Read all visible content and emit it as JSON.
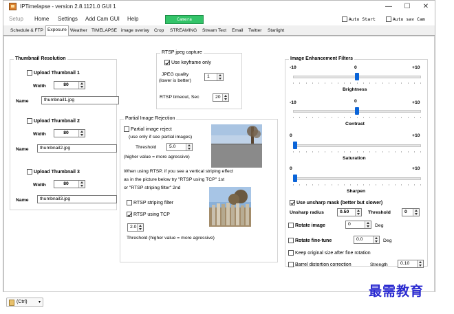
{
  "window": {
    "title": "IPTimelapse - version 2.8.1121.0   GUI 1",
    "minimize_glyph": "—",
    "maximize_glyph": "☐",
    "close_glyph": "✕"
  },
  "menu": {
    "items": [
      "Setup",
      "Home",
      "Settings",
      "Add Cam GUI",
      "Help"
    ],
    "camera_button": "Camera",
    "auto_start_label": "Auto Start",
    "auto_start_checked": false,
    "auto_sav_cam_label": "Auto sav Cam",
    "auto_sav_cam_checked": false
  },
  "tabs": [
    "Schedule & FTP",
    "Exposure",
    "Weather",
    "TIMELAPSE",
    "image overlay",
    "Crop",
    "STREAMING",
    "Stream Text",
    "Email",
    "Twitter",
    "Starlight"
  ],
  "active_tab": "Exposure",
  "thumbnail": {
    "group_title": "Thumbnail Resolution",
    "width_label": "Width",
    "name_label": "Name",
    "items": [
      {
        "label": "Upload Thumbnail 1",
        "checked": false,
        "width": "80",
        "name": "thumbnail1.jpg"
      },
      {
        "label": "Upload Thumbnail 2",
        "checked": false,
        "width": "80",
        "name": "thumbnail2.jpg"
      },
      {
        "label": "Upload Thumbnail 3",
        "checked": false,
        "width": "80",
        "name": "thumbnail3.jpg"
      }
    ]
  },
  "rtsp": {
    "group_title": "RTSP jpeg capture",
    "use_keyframe_label": "Use keyframe only",
    "use_keyframe_checked": true,
    "jpeg_quality_label_1": "JPEG quality",
    "jpeg_quality_label_2": "(lower is better)",
    "jpeg_quality": "1",
    "timeout_label": "RTSP timeout, Sec",
    "timeout": "20"
  },
  "partial": {
    "group_title": "Partial Image Rejection",
    "reject_label": "Partial image reject",
    "reject_checked": false,
    "reject_hint": "(use only if see partial images)",
    "threshold_label": "Threshold",
    "threshold": "5.0",
    "threshold_hint": "(higher value = more agressive)",
    "striping_note_1": "When using RTSP, if you see a vertical striping effect",
    "striping_note_2": "as in the picture below try \"RTSP using TCP\" 1st",
    "striping_note_3": "or \"RTSP striping filter\" 2nd",
    "striping_filter_label": "RTSP striping filter",
    "striping_filter_checked": false,
    "using_tcp_label": "RTSP using TCP",
    "using_tcp_checked": true,
    "filter_value": "2.0",
    "filter_threshold_hint": "Threshold (higher value = more agressive)"
  },
  "enhancement": {
    "group_title": "Image Enhancement Filters",
    "sliders": [
      {
        "name": "Brightness",
        "min_label": "-10",
        "mid_label": "0",
        "max_label": "+10",
        "value": 0,
        "min": -10,
        "max": 10
      },
      {
        "name": "Contrast",
        "min_label": "-10",
        "mid_label": "0",
        "max_label": "+10",
        "value": 0,
        "min": -10,
        "max": 10
      },
      {
        "name": "Saturation",
        "min_label": "0",
        "mid_label": "",
        "max_label": "+10",
        "value": 0,
        "min": 0,
        "max": 10
      },
      {
        "name": "Sharpen",
        "min_label": "0",
        "mid_label": "",
        "max_label": "+10",
        "value": 0,
        "min": 0,
        "max": 10
      }
    ],
    "unsharp_label": "Use unsharp mask (better but slower)",
    "unsharp_checked": true,
    "unsharp_radius_label": "Unsharp radius",
    "unsharp_radius": "0.50",
    "unsharp_threshold_label": "Threshold",
    "unsharp_threshold": "0",
    "rotate_label": "Rotate image",
    "rotate_checked": false,
    "rotate_value": "0",
    "rotate_unit": "Deg",
    "finetune_label": "Rotate fine-tune",
    "finetune_checked": false,
    "finetune_value": "0.0",
    "finetune_unit": "Deg",
    "keep_size_label": "Keep original size after fine rotation",
    "keep_size_checked": false,
    "barrel_label": "Barrel distortion correction",
    "barrel_checked": false,
    "strength_label": "Strength",
    "strength_value": "0.10"
  },
  "watermark": "最需教育",
  "ctrl_badge": "(Ctrl)"
}
